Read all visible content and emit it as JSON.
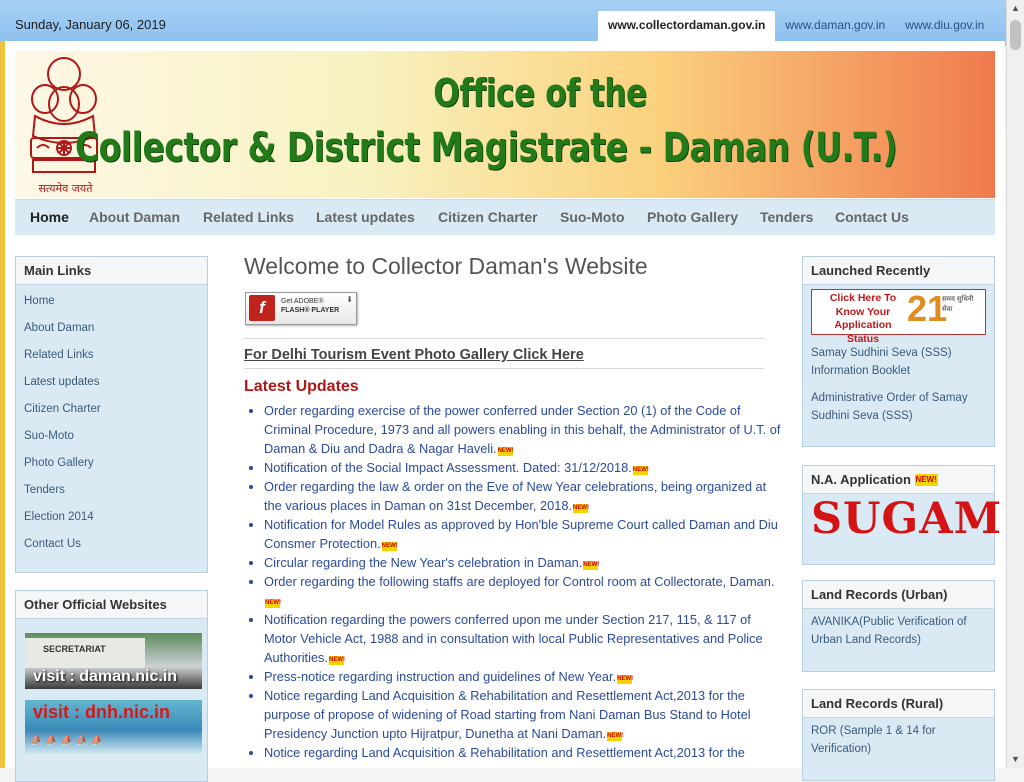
{
  "topbar": {
    "date": "Sunday, January 06, 2019",
    "sites": [
      "www.collectordaman.gov.in",
      "www.daman.gov.in",
      "www.diu.gov.in"
    ]
  },
  "banner": {
    "line1": "Office of the",
    "line2": "Collector & District Magistrate - Daman (U.T.)",
    "motto": "सत्यमेव जयते"
  },
  "nav": [
    "Home",
    "About Daman",
    "Related Links",
    "Latest updates",
    "Citizen Charter",
    "Suo-Moto",
    "Photo Gallery",
    "Tenders",
    "Contact Us"
  ],
  "main_links": {
    "title": "Main Links",
    "items": [
      "Home",
      "About Daman",
      "Related Links",
      "Latest updates",
      "Citizen Charter",
      "Suo-Moto",
      "Photo Gallery",
      "Tenders",
      "Election 2014",
      "Contact Us"
    ]
  },
  "other_sites": {
    "title": "Other Official Websites",
    "daman": "visit : daman.nic.in",
    "daman_building": "SECRETARIAT",
    "dnh": "visit : dnh.nic.in"
  },
  "main": {
    "title": "Welcome to Collector Daman's Website",
    "flash_line1": "Get ADOBE®",
    "flash_line2": "FLASH® PLAYER",
    "delhi_link": "For Delhi Tourism Event Photo Gallery Click Here",
    "latest_title": "Latest Updates",
    "new_label": "NEW!",
    "updates": [
      "Order regarding exercise of the power conferred under Section 20 (1) of the Code of Criminal Procedure, 1973 and all powers enabling in this behalf, the Administrator of U.T. of Daman & Diu and Dadra & Nagar Haveli.",
      "Notification of the Social Impact Assessment. Dated: 31/12/2018.",
      "Order regarding the law & order on the Eve of New Year celebrations, being organized at the various places in Daman on 31st December, 2018.",
      "Notification for Model Rules as approved by Hon'ble Supreme Court called Daman and Diu Consmer Protection.",
      "Circular regarding the New Year's celebration in Daman.",
      "Order regarding the following staffs are deployed for Control room at Collectorate, Daman.",
      "Notification regarding the powers conferred upon me under Section 217, 115, & 117 of Motor Vehicle Act, 1988 and in consultation with local Public Representatives and Police Authorities.",
      "Press-notice regarding instruction and guidelines of New Year.",
      "Notice regarding Land Acquisition & Rehabilitation and Resettlement Act,2013 for the purpose of propose of widening of Road starting from Nani Daman Bus Stand to Hotel Presidency Junction upto Hijratpur, Dunetha at Nani Daman.",
      "Notice regarding Land Acquisition & Rehabilitation and Resettlement Act,2013 for the"
    ]
  },
  "right": {
    "launched_title": "Launched Recently",
    "launched_img": "Click Here To Know Your Application Status",
    "launched_img_num": "21",
    "launched_img_hindi": "समय सुधिनी सेवा",
    "sss_booklet": "Samay Sudhini Seva (SSS) Information Booklet",
    "sss_order": "Administrative Order of Samay Sudhini Seva (SSS)",
    "na_title": "N.A. Application",
    "na_img": "SUGAM",
    "land_urban_title": "Land Records (Urban)",
    "land_urban_link": "AVANIKA(Public Verification of Urban Land Records)",
    "land_rural_title": "Land Records (Rural)",
    "land_rural_link": "ROR (Sample 1 & 14 for Verification)"
  }
}
